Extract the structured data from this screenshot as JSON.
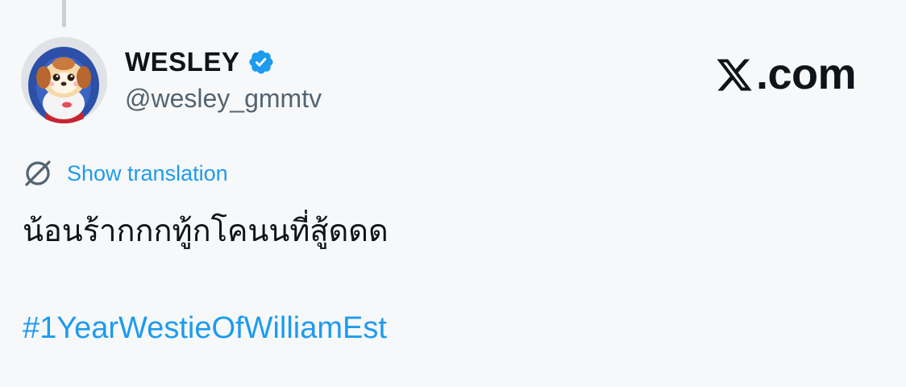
{
  "author": {
    "display_name": "WESLEY",
    "handle": "@wesley_gmmtv",
    "verified": true,
    "verified_color": "#1d9bf0",
    "avatar_icon": "cartoon-dog-mascot-avatar"
  },
  "brand": {
    "domain_suffix": ".com",
    "logo_icon": "x-logo-icon"
  },
  "translation": {
    "label": "Show translation",
    "icon": "globe-translate-icon"
  },
  "tweet": {
    "text": "น้อนร้ากกกทู้กโคนนที่สู้ดดด",
    "hashtag": "#1YearWestieOfWilliamEst"
  },
  "colors": {
    "background": "#f7f8f9",
    "text_primary": "#0f1419",
    "text_secondary": "#536471",
    "link": "#1d9bf0"
  }
}
